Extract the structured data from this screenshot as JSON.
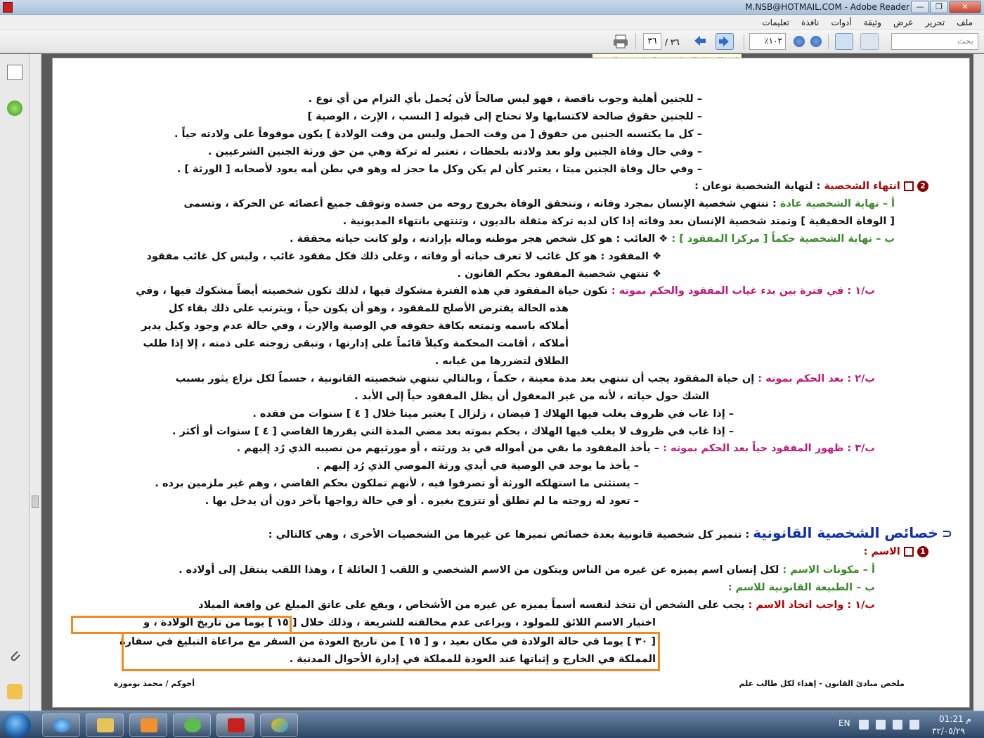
{
  "window": {
    "title": "M.NSB@HOTMAIL.COM - Adobe Reader",
    "minimize": "—",
    "maximize": "❐",
    "close": "✕"
  },
  "menu": [
    "ملف",
    "تحرير",
    "عرض",
    "وثيقة",
    "أدوات",
    "نافذة",
    "تعليمات"
  ],
  "toolbar": {
    "search_placeholder": "بحث",
    "zoom": "١٠٢٪",
    "page_current": "٣٦",
    "page_total": "/ ٣٦",
    "tooltip": "انقر للانتقال إلى الصفحة السابقة في الوثيقة"
  },
  "document": {
    "lines": [
      "–   للجنين أهلية وجوب ناقصة ، فهو ليس صالحاً لأن يُحمل بأي التزام من أي نوع .",
      "–   للجنين حقوق صالحة لاكتسابها ولا تحتاج إلى قبوله [ النسب ، الإرث ، الوصية ]",
      "–   كل ما يكتسبه الجنين من حقوق [ من وقت الحمل وليس من وقت الولادة ] يكون موقوفاً على ولادته حياً .",
      "–   وفي حال وفاة الجنين ولو بعد ولادته بلحظات ، تعتبر له تركة وهي من حق ورثة الجنين الشرعيين .",
      "–   وفي حال وفاة الجنين ميتا ، يعتبر كأن لم يكن وكل ما حجز له وهو في بطن أمه يعود لأصحابه [ الورثة ] ."
    ],
    "end_heading": "انتهاء الشخصية",
    "end_heading_rest": ": لنهاية الشخصية نوعان :",
    "natural_label": "أ –   نهاية الشخصية عادة",
    "natural_text": ": تنتهي شخصية الإنسان بمجرد وفاته ، وتتحقق الوفاة بخروج روحه من جسده وتوقف جميع أعضائه عن الحركة ، وتسمى",
    "natural_text2": "[ الوفاة الحقيقية ] وتمتد شخصية الإنسان بعد وفاته إذا كان لديه تركة مثقلة بالديون ، وتنتهي بانتهاء المديونية .",
    "legal_label": "ب –   نهاية الشخصية حكماً [ مركزا المفقود ] :",
    "legal_text": "❖ الغائب : هو كل شخص هجر موطنه وماله بإرادته ، ولو كانت حياته محققة .",
    "missing_def": "❖ المفقود : هو كل غائب لا تعرف حياته أو وفاته ، وعلى ذلك فكل مفقود غائب ، وليس كل غائب مفقود",
    "missing_end": "❖ تنتهي شخصية المفقود بحكم القانون .",
    "b1_label": "ب/١ :  في فترة بين بدء غياب المفقود والحكم بموته :",
    "b1_lines": [
      "تكون حياة المفقود في هذه الفترة مشكوك فيها ، لذلك تكون شخصيته أيضاً مشكوك فيها ، وفي",
      "هذه الحالة يفترض الأصلح للمفقود ، وهو أن يكون حياً ، ويترتب على ذلك بقاء كل",
      "أملاكه باسمه وتمتعه بكافة حقوقه في الوصية والإرث ، وفي حالة عدم وجود وكيل يدير",
      "أملاكه ، أقامت المحكمة وكيلاً قائماً على إدارتها ، وتبقى زوجته على ذمته ، إلا إذا طلب",
      "الطلاق لتضررها من غيابه ."
    ],
    "b2_label": "ب/٢ :  بعد الحكم بموته :",
    "b2_line1": "إن حياة المفقود يجب أن تنتهي بعد مدة معينة ، حكماً ، وبالتالي تنتهي شخصيته القانونية ، حسماً لكل نزاع يثور بسبب",
    "b2_line2": "الشك حول حياته ، لأنه من غير المعقول أن يظل المفقود حياً إلى الأبد .",
    "b2_sub1": "–   إذا غاب في ظروف يغلب فيها الهلاك [ فيضان ، زلزال ] يعتبر ميتا خلال [ ٤ ] سنوات من فقده .",
    "b2_sub2": "–   إذا غاب في ظروف لا يغلب فيها الهلاك ، يحكم بموته بعد مضي المدة التي يقررها القاضي [ ٤ ] سنوات أو أكثر .",
    "b3_label": "ب/٣ : ظهور المفقود حياً بعد الحكم بموته :",
    "b3_lines": [
      "–   يأخذ المفقود ما بقي من أمواله في يد ورثته ، أو مورثيهم من نصيبه الذي رُد إليهم .",
      "–   يأخذ ما يوجد في الوصية في أيدي ورثة الموصي الذي رُد إليهم .",
      "–   يستثنى ما استهلكه الورثة أو تصرفوا فيه ، لأنهم تملكون بحكم القاضي ، وهم غير ملزمين برده .",
      "–   تعود له زوجته ما لم تطلق أو تتزوج بغيره . أو في حالة زواجها بآخر دون أن يدخل بها ."
    ],
    "features_heading": "خصائص الشخصية القانونية",
    "features_rest": ": تتميز كل شخصية قانونية بعدة خصائص تميزها عن غيرها من الشخصيات الأخرى ، وهي كالتالي :",
    "name_heading": "الاسم :",
    "a_label": "أ – مكونات الاسم :",
    "a_text": "لكل إنسان اسم يميزه عن غيره من الناس ويتكون من الاسم الشخصي و اللقب [ العائلة ] ، وهذا اللقب ينتقل إلى أولاده .",
    "b_label": "ب – الطبيعة القانونية للاسم :",
    "b1n_label": "ب/١ : واجب اتخاذ الاسم :",
    "b1n_text": "يجب على الشخص أن تتخذ لنفسه أسماً يميزه عن غيره من الأشخاص ، ويقع على عاتق المبلغ عن واقعة الميلاد",
    "b1n_line2": "اختيار الاسم اللائق للمولود ، ويراعى عدم مخالفته للشريعة ، وذلك خلال [ ١٥ ] يوما من تاريخ الولادة ، و",
    "b1n_line3": "[ ٣٠ ] يوما في حالة الولادة في مكان بعيد ، و [ ١٥ ] من تاريخ العودة من السفر مع مراعاة التبليغ في سفارة",
    "b1n_line4": "المملكة في الخارج و إثباتها عند العودة للمملكة في إدارة الأحوال المدنية .",
    "footer_right": "ملخص مبادئ القانون  -  إهداء لكل طالب علم",
    "footer_left": "أخوكم  /  محمد بوموزة",
    "num2": "2",
    "num1": "1",
    "feat_bullet": "⊂"
  },
  "taskbar": {
    "lang": "EN",
    "time": "01:21 م",
    "date": "٣٢/٠٥/٢٩"
  }
}
